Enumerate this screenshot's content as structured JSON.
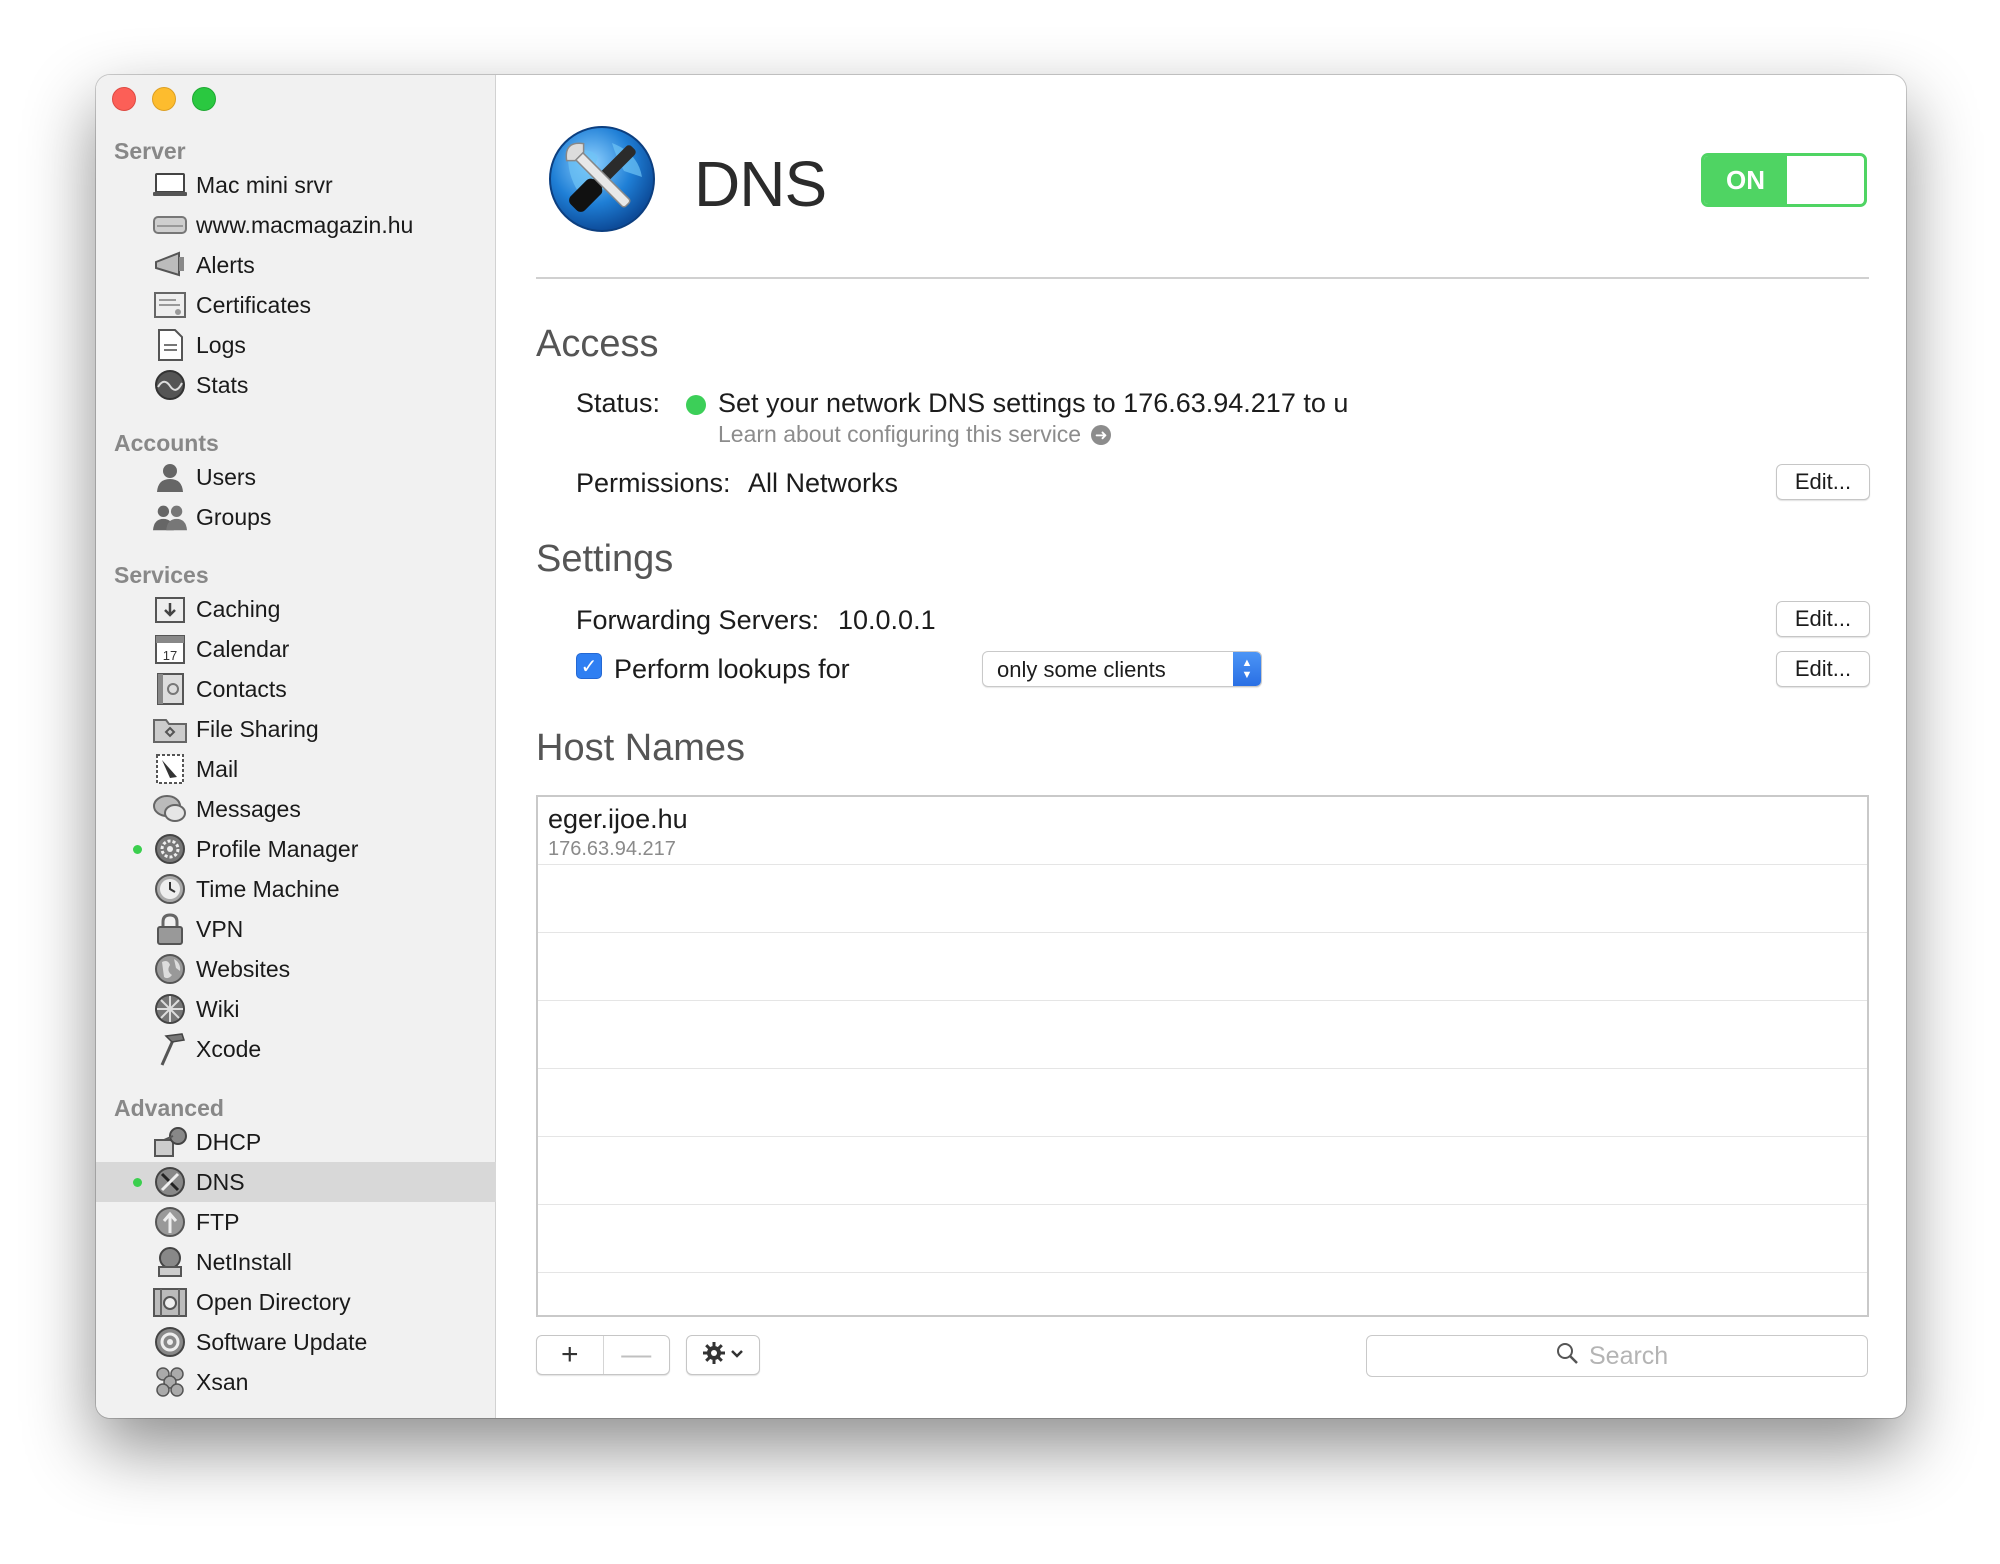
{
  "sidebar": {
    "sections": [
      {
        "label": "Server",
        "items": [
          {
            "label": "Mac mini srvr",
            "icon": "laptop-icon",
            "dot": false,
            "selected": false
          },
          {
            "label": "www.macmagazin.hu",
            "icon": "drive-icon",
            "dot": false,
            "selected": false
          },
          {
            "label": "Alerts",
            "icon": "megaphone-icon",
            "dot": false,
            "selected": false
          },
          {
            "label": "Certificates",
            "icon": "certificate-icon",
            "dot": false,
            "selected": false
          },
          {
            "label": "Logs",
            "icon": "document-icon",
            "dot": false,
            "selected": false
          },
          {
            "label": "Stats",
            "icon": "graph-icon",
            "dot": false,
            "selected": false
          }
        ]
      },
      {
        "label": "Accounts",
        "items": [
          {
            "label": "Users",
            "icon": "user-icon",
            "dot": false,
            "selected": false
          },
          {
            "label": "Groups",
            "icon": "group-icon",
            "dot": false,
            "selected": false
          }
        ]
      },
      {
        "label": "Services",
        "items": [
          {
            "label": "Caching",
            "icon": "download-box-icon",
            "dot": false,
            "selected": false
          },
          {
            "label": "Calendar",
            "icon": "calendar-icon",
            "dot": false,
            "selected": false,
            "badge": "17"
          },
          {
            "label": "Contacts",
            "icon": "contacts-book-icon",
            "dot": false,
            "selected": false
          },
          {
            "label": "File Sharing",
            "icon": "folder-icon",
            "dot": false,
            "selected": false
          },
          {
            "label": "Mail",
            "icon": "stamp-icon",
            "dot": false,
            "selected": false
          },
          {
            "label": "Messages",
            "icon": "chat-bubbles-icon",
            "dot": false,
            "selected": false
          },
          {
            "label": "Profile Manager",
            "icon": "gear-disc-icon",
            "dot": true,
            "selected": false
          },
          {
            "label": "Time Machine",
            "icon": "clock-icon",
            "dot": false,
            "selected": false
          },
          {
            "label": "VPN",
            "icon": "lock-icon",
            "dot": false,
            "selected": false
          },
          {
            "label": "Websites",
            "icon": "globe-icon",
            "dot": false,
            "selected": false
          },
          {
            "label": "Wiki",
            "icon": "wiki-wheel-icon",
            "dot": false,
            "selected": false
          },
          {
            "label": "Xcode",
            "icon": "hammer-icon",
            "dot": false,
            "selected": false
          }
        ]
      },
      {
        "label": "Advanced",
        "items": [
          {
            "label": "DHCP",
            "icon": "network-icon",
            "dot": false,
            "selected": false
          },
          {
            "label": "DNS",
            "icon": "dns-globe-icon",
            "dot": true,
            "selected": true
          },
          {
            "label": "FTP",
            "icon": "ftp-icon",
            "dot": false,
            "selected": false
          },
          {
            "label": "NetInstall",
            "icon": "netinstall-icon",
            "dot": false,
            "selected": false
          },
          {
            "label": "Open Directory",
            "icon": "directory-icon",
            "dot": false,
            "selected": false
          },
          {
            "label": "Software Update",
            "icon": "update-icon",
            "dot": false,
            "selected": false
          },
          {
            "label": "Xsan",
            "icon": "xsan-icon",
            "dot": false,
            "selected": false
          }
        ]
      }
    ]
  },
  "header": {
    "title": "DNS",
    "toggle_label": "ON",
    "toggle_state": "on"
  },
  "access": {
    "heading": "Access",
    "status_label": "Status:",
    "status_text": "Set your network DNS settings to 176.63.94.217 to u",
    "status_color": "#3ccf58",
    "learn_link": "Learn about configuring this service",
    "permissions_label": "Permissions:",
    "permissions_value": "All Networks",
    "edit_label": "Edit..."
  },
  "settings": {
    "heading": "Settings",
    "forwarding_label": "Forwarding Servers:",
    "forwarding_value": "10.0.0.1",
    "forwarding_edit": "Edit...",
    "lookups_label": "Perform lookups for",
    "lookups_checked": true,
    "lookups_select": "only some clients",
    "lookups_edit": "Edit..."
  },
  "hostnames": {
    "heading": "Host Names",
    "rows": [
      {
        "host": "eger.ijoe.hu",
        "ip": "176.63.94.217"
      }
    ]
  },
  "footer": {
    "add_label": "+",
    "remove_label": "—",
    "search_placeholder": "Search"
  },
  "colors": {
    "accent": "#4fd463",
    "selection": "#2f7ff2"
  }
}
